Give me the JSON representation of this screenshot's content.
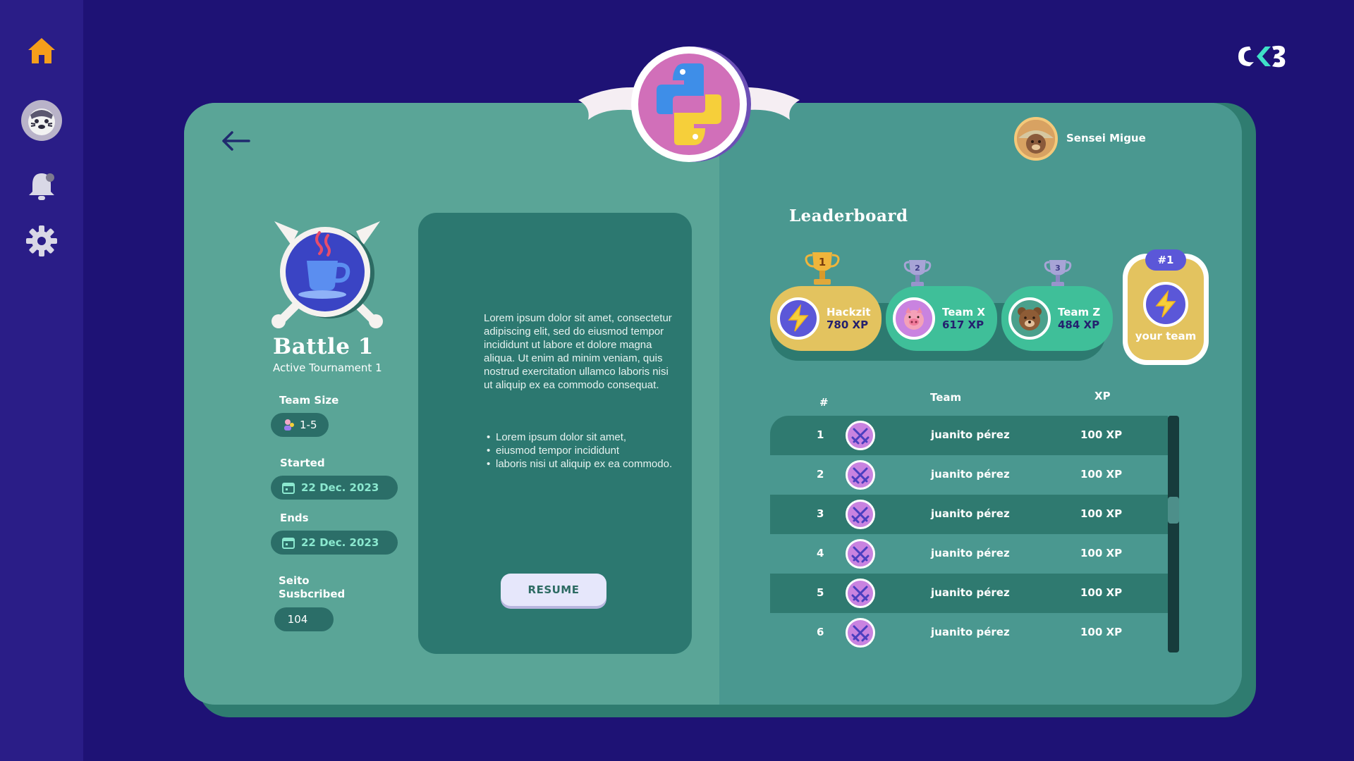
{
  "user": {
    "name": "Sensei Migue"
  },
  "battle": {
    "title": "Battle 1",
    "subtitle": "Active Tournament 1",
    "team_size_label": "Team Size",
    "team_size_value": "1-5",
    "started_label": "Started",
    "started_value": "22 Dec. 2023",
    "ends_label": "Ends",
    "ends_value": "22 Dec. 2023",
    "subscribed_label_1": "Seito",
    "subscribed_label_2": "Susbcribed",
    "subscribed_value": "104"
  },
  "description": {
    "paragraph": "Lorem ipsum dolor sit amet, consectetur adipiscing elit, sed do eiusmod tempor incididunt ut labore et dolore magna aliqua. Ut enim ad minim veniam, quis nostrud exercitation ullamco laboris nisi ut aliquip ex ea commodo consequat.",
    "bullets": [
      "Lorem ipsum dolor sit amet,",
      "eiusmod tempor incididunt",
      "laboris nisi ut aliquip ex ea commodo."
    ],
    "resume_label": "RESUME"
  },
  "leaderboard": {
    "title": "Leaderboard",
    "podium": [
      {
        "rank": "1",
        "name": "Hackzit",
        "xp": "780 XP",
        "color": "#e3c35f"
      },
      {
        "rank": "2",
        "name": "Team X",
        "xp": "617 XP",
        "color": "#3fbf99"
      },
      {
        "rank": "3",
        "name": "Team Z",
        "xp": "484 XP",
        "color": "#3fbf99"
      }
    ],
    "your_team": {
      "rank": "#1",
      "label": "your team"
    },
    "columns": {
      "rank": "#",
      "team": "Team",
      "xp": "XP"
    },
    "rows": [
      {
        "rank": "1",
        "name": "juanito pérez",
        "xp": "100 XP"
      },
      {
        "rank": "2",
        "name": "juanito pérez",
        "xp": "100 XP"
      },
      {
        "rank": "3",
        "name": "juanito pérez",
        "xp": "100 XP"
      },
      {
        "rank": "4",
        "name": "juanito pérez",
        "xp": "100 XP"
      },
      {
        "rank": "5",
        "name": "juanito pérez",
        "xp": "100 XP"
      },
      {
        "rank": "6",
        "name": "juanito pérez",
        "xp": "100 XP"
      }
    ]
  },
  "colors": {
    "background": "#1e1275",
    "sidebar": "#2a1d87",
    "accent_home": "#f59e1b",
    "gold": "#e3c35f",
    "green": "#3fbf99",
    "purple": "#5b57d8"
  },
  "icons": [
    "home-icon",
    "tiger-avatar-icon",
    "bell-icon",
    "gear-icon",
    "back-arrow-icon",
    "python-logo-icon",
    "coffee-cup-icon",
    "calendar-icon",
    "trophy-icon",
    "lightning-icon",
    "pig-icon",
    "bear-icon",
    "swords-icon"
  ]
}
